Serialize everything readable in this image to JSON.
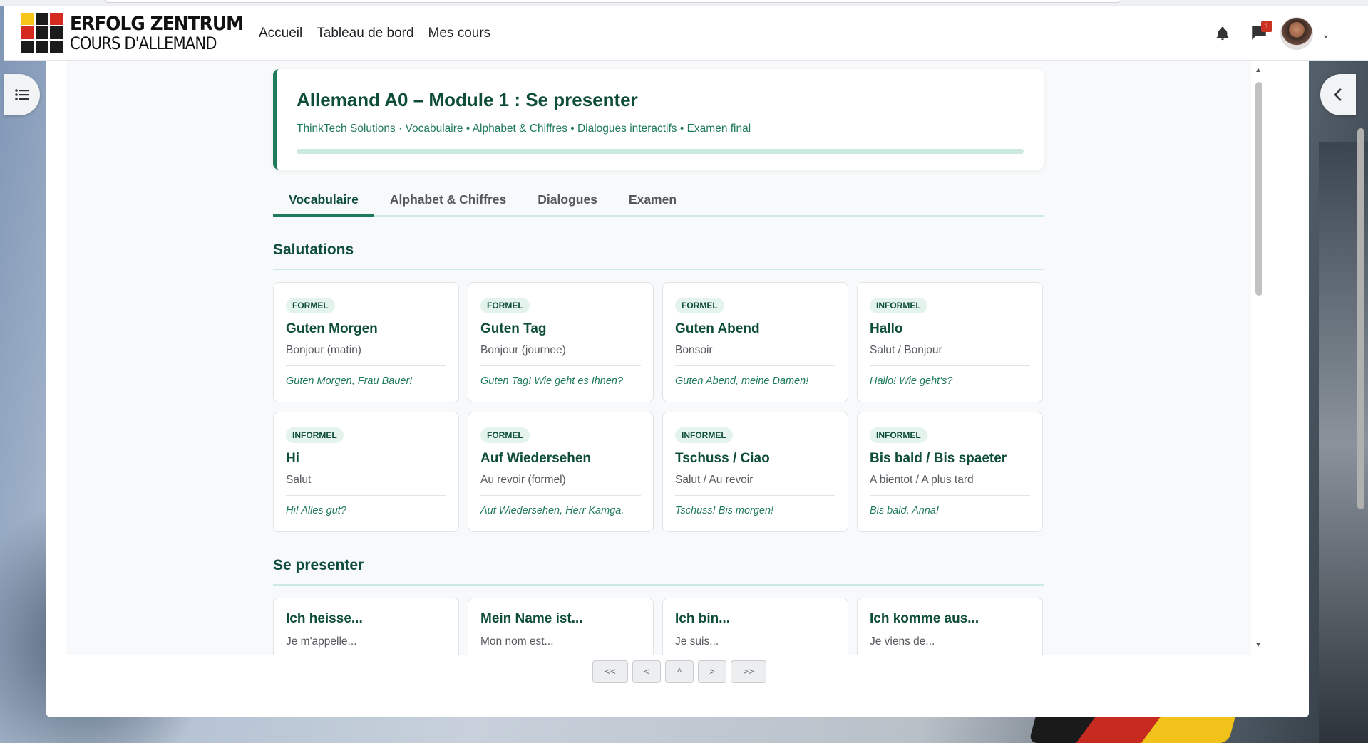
{
  "brand": {
    "line1": "ERFOLG ZENTRUM",
    "line2": "COURS D'ALLEMAND"
  },
  "nav": {
    "links": [
      "Accueil",
      "Tableau de bord",
      "Mes cours"
    ],
    "notification_count": "1",
    "icons": [
      "bell-icon",
      "chat-icon",
      "chevron-down-icon"
    ]
  },
  "course": {
    "title": "Allemand A0 – Module 1 : Se presenter",
    "subtitle": "ThinkTech Solutions · Vocabulaire • Alphabet & Chiffres • Dialogues interactifs • Examen final",
    "progress_percent": 100
  },
  "tabs": [
    "Vocabulaire",
    "Alphabet & Chiffres",
    "Dialogues",
    "Examen"
  ],
  "active_tab": "Vocabulaire",
  "sections": {
    "salutations": {
      "title": "Salutations",
      "cards": [
        {
          "tag": "FORMEL",
          "de": "Guten Morgen",
          "fr": "Bonjour (matin)",
          "ex": "Guten Morgen, Frau Bauer!"
        },
        {
          "tag": "FORMEL",
          "de": "Guten Tag",
          "fr": "Bonjour (journee)",
          "ex": "Guten Tag! Wie geht es Ihnen?"
        },
        {
          "tag": "FORMEL",
          "de": "Guten Abend",
          "fr": "Bonsoir",
          "ex": "Guten Abend, meine Damen!"
        },
        {
          "tag": "INFORMEL",
          "de": "Hallo",
          "fr": "Salut / Bonjour",
          "ex": "Hallo! Wie geht's?"
        },
        {
          "tag": "INFORMEL",
          "de": "Hi",
          "fr": "Salut",
          "ex": "Hi! Alles gut?"
        },
        {
          "tag": "FORMEL",
          "de": "Auf Wiedersehen",
          "fr": "Au revoir (formel)",
          "ex": "Auf Wiedersehen, Herr Kamga."
        },
        {
          "tag": "INFORMEL",
          "de": "Tschuss / Ciao",
          "fr": "Salut / Au revoir",
          "ex": "Tschuss! Bis morgen!"
        },
        {
          "tag": "INFORMEL",
          "de": "Bis bald / Bis spaeter",
          "fr": "A bientot / A plus tard",
          "ex": "Bis bald, Anna!"
        }
      ]
    },
    "presenter": {
      "title": "Se presenter",
      "cards": [
        {
          "de": "Ich heisse...",
          "fr": "Je m'appelle..."
        },
        {
          "de": "Mein Name ist...",
          "fr": "Mon nom est..."
        },
        {
          "de": "Ich bin...",
          "fr": "Je suis..."
        },
        {
          "de": "Ich komme aus...",
          "fr": "Je viens de..."
        }
      ]
    }
  },
  "pager": [
    "<<",
    "<",
    "^",
    ">",
    ">>"
  ],
  "colors": {
    "accent": "#1f7a5a",
    "heading": "#0f4d3b",
    "tag_bg": "#e4f4ed",
    "badge": "#ca3120"
  }
}
